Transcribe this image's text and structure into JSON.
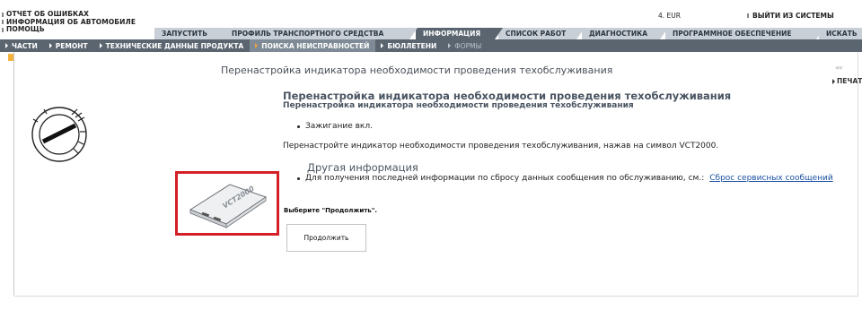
{
  "util_links": [
    {
      "label": "ОТЧЕТ ОБ ОШИБКАХ"
    },
    {
      "label": "ИНФОРМАЦИЯ ОБ АВТОМОБИЛЕ"
    },
    {
      "label": "ПОМОЩЬ"
    }
  ],
  "header": {
    "currency": "4. EUR",
    "logout": "ВЫЙТИ ИЗ СИСТЕМЫ"
  },
  "tabs": [
    {
      "label": "ЗАПУСТИТЬ",
      "active": false
    },
    {
      "label": "ПРОФИЛЬ ТРАНСПОРТНОГО СРЕДСТВА",
      "active": false
    },
    {
      "label": "ИНФОРМАЦИЯ",
      "active": true
    },
    {
      "label": "СПИСОК РАБОТ",
      "active": false
    },
    {
      "label": "ДИАГНОСТИКА",
      "active": false
    },
    {
      "label": "ПРОГРАММНОЕ ОБЕСПЕЧЕНИЕ",
      "active": false
    },
    {
      "label": "ИСКАТЬ",
      "active": false
    }
  ],
  "subnav": [
    {
      "label": "ЧАСТИ",
      "state": "normal"
    },
    {
      "label": "РЕМОНТ",
      "state": "normal"
    },
    {
      "label": "ТЕХНИЧЕСКИЕ ДАННЫЕ ПРОДУКТА",
      "state": "normal"
    },
    {
      "label": "ПОИСКА НЕИСПРАВНОСТЕЙ",
      "state": "active"
    },
    {
      "label": "БЮЛЛЕТЕНИ",
      "state": "normal"
    },
    {
      "label": "ФОРМЫ",
      "state": "dim"
    }
  ],
  "content": {
    "title": "Перенастройка индикатора необходимости проведения техобслуживания",
    "back_icon": "««",
    "print_label": "ПЕЧАТ",
    "heading": "Перенастройка индикатора необходимости проведения техобслуживания",
    "subheading": "Перенастройка индикатора необходимости проведения техобслуживания",
    "step_bullet": "Зажигание вкл.",
    "instruction": "Перенастройте индикатор необходимости проведения техобслуживания, нажав на символ VCT2000.",
    "other_info_heading": "Другая информация",
    "other_info_text": "Для получения последней информации по сбросу данных сообщения по обслуживанию, см.:",
    "other_info_link": "Сброс сервисных сообщений",
    "choose_text": "Выберите \"Продолжить\".",
    "continue_button": "Продолжить",
    "device_label": "VCT2000"
  },
  "colors": {
    "nav_dark": "#5a6570",
    "tab_light": "#c9cfd6",
    "highlight_red": "#d41f26",
    "link_blue": "#1a4fa3",
    "marker_orange": "#f3b33d"
  }
}
